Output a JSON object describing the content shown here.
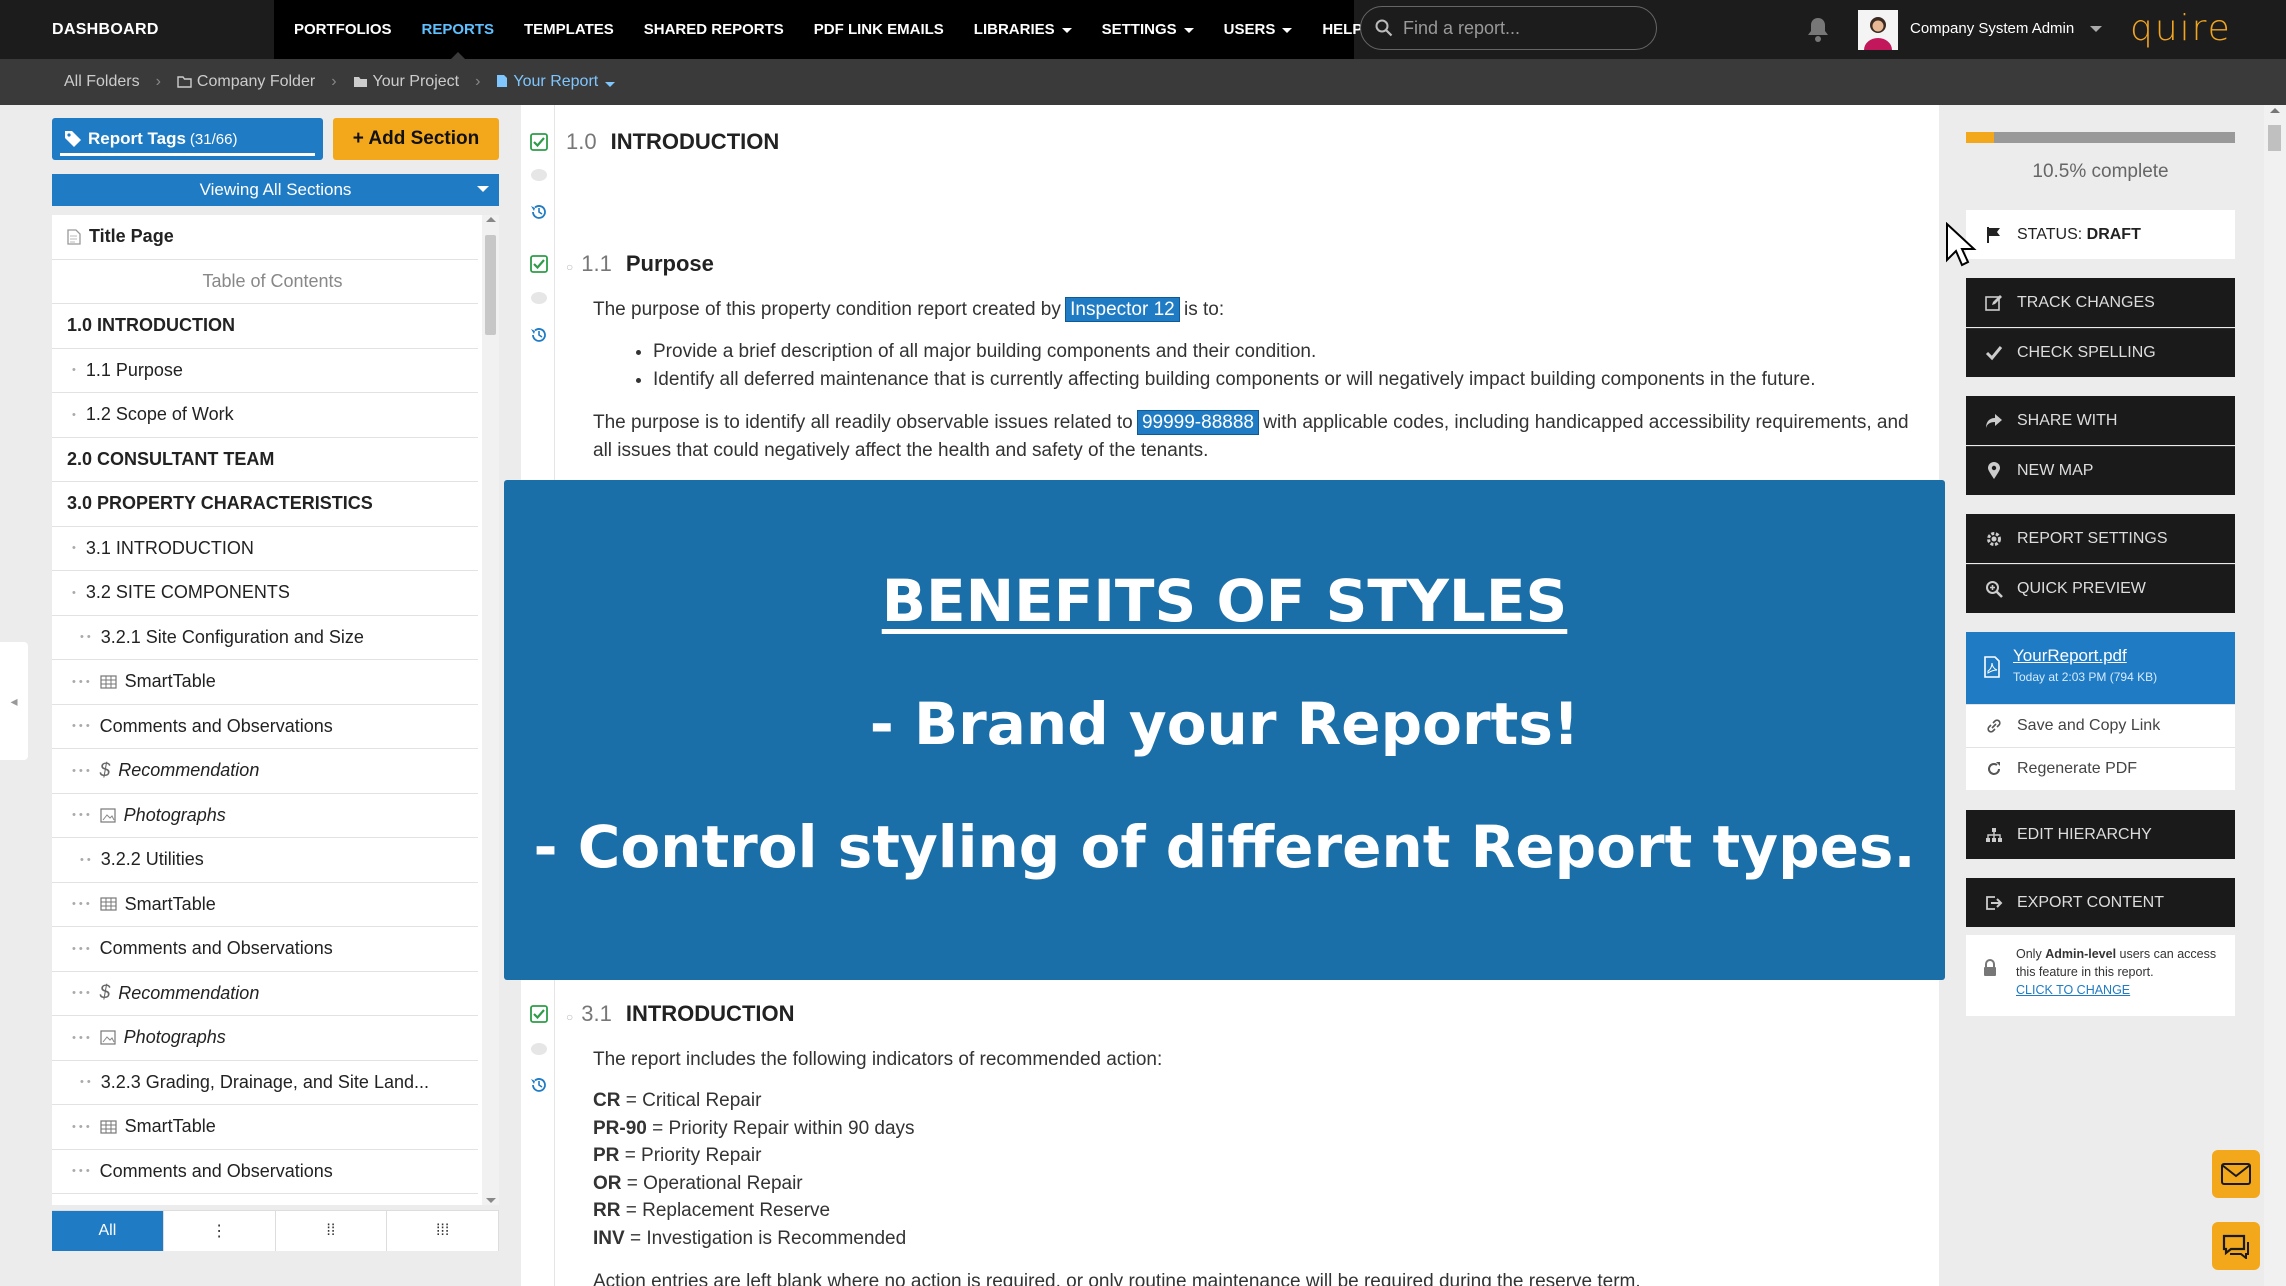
{
  "nav": {
    "dashboard": "DASHBOARD",
    "items": [
      {
        "label": "PORTFOLIOS",
        "caret": false
      },
      {
        "label": "REPORTS",
        "caret": false,
        "active": true
      },
      {
        "label": "TEMPLATES",
        "caret": false
      },
      {
        "label": "SHARED REPORTS",
        "caret": false
      },
      {
        "label": "PDF LINK EMAILS",
        "caret": false
      },
      {
        "label": "LIBRARIES",
        "caret": true
      },
      {
        "label": "SETTINGS",
        "caret": true
      },
      {
        "label": "USERS",
        "caret": true
      },
      {
        "label": "HELP",
        "caret": false
      }
    ],
    "search_placeholder": "Find a report...",
    "user_name": "Company System Admin",
    "logo": "quire"
  },
  "breadcrumb": {
    "items": [
      "All Folders",
      "Company Folder",
      "Your Project",
      "Your Report"
    ]
  },
  "left": {
    "tags_label": "Report Tags",
    "tags_count": "(31/66)",
    "add_section": "+ Add Section",
    "viewing": "Viewing All Sections",
    "toc": [
      {
        "label": "Title Page",
        "style": "bold",
        "indent": 0,
        "icon": "page"
      },
      {
        "label": "Table of Contents",
        "style": "center",
        "indent": 0
      },
      {
        "label": "1.0 INTRODUCTION",
        "style": "bold",
        "indent": 0
      },
      {
        "label": "1.1 Purpose",
        "indent": 1
      },
      {
        "label": "1.2 Scope of Work",
        "indent": 1
      },
      {
        "label": "2.0 CONSULTANT TEAM",
        "style": "bold",
        "indent": 0
      },
      {
        "label": "3.0 PROPERTY CHARACTERISTICS",
        "style": "bold",
        "indent": 0
      },
      {
        "label": "3.1 INTRODUCTION",
        "indent": 1
      },
      {
        "label": "3.2 SITE COMPONENTS",
        "indent": 1
      },
      {
        "label": "3.2.1 Site Configuration and Size",
        "indent": 2
      },
      {
        "label": "SmartTable",
        "indent": 3,
        "icon": "table"
      },
      {
        "label": "Comments and Observations",
        "indent": 3
      },
      {
        "label": "Recommendation",
        "style": "italic",
        "indent": 3,
        "icon": "dollar"
      },
      {
        "label": "Photographs",
        "style": "italic",
        "indent": 3,
        "icon": "image"
      },
      {
        "label": "3.2.2 Utilities",
        "indent": 2
      },
      {
        "label": "SmartTable",
        "indent": 3,
        "icon": "table"
      },
      {
        "label": "Comments and Observations",
        "indent": 3
      },
      {
        "label": "Recommendation",
        "style": "italic",
        "indent": 3,
        "icon": "dollar"
      },
      {
        "label": "Photographs",
        "style": "italic",
        "indent": 3,
        "icon": "image"
      },
      {
        "label": "3.2.3 Grading, Drainage, and Site Land...",
        "indent": 2
      },
      {
        "label": "SmartTable",
        "indent": 3,
        "icon": "table"
      },
      {
        "label": "Comments and Observations",
        "indent": 3
      }
    ],
    "bottom_tabs": [
      "All",
      "⋮",
      "⁞⁞",
      "⁞⁞⁞"
    ]
  },
  "doc": {
    "s1_num": "1.0",
    "s1_title": "INTRODUCTION",
    "s11_num": "1.1",
    "s11_title": "Purpose",
    "p1_before": "The purpose of this property condition report created by",
    "p1_tag": "Inspector 12",
    "p1_after": "is to:",
    "bullets": [
      "Provide a brief description of all major building components and their condition.",
      "Identify all deferred maintenance that is currently affecting building components or will negatively impact building components in the future."
    ],
    "p2_before": "The purpose is to identify all readily observable issues related to",
    "p2_tag": "99999-88888",
    "p2_after": "with applicable codes, including handicapped accessibility requirements, and all issues that could negatively affect the health and safety of the tenants.",
    "s31_num": "3.1",
    "s31_title": "INTRODUCTION",
    "p3": "The report includes the following indicators of recommended action:",
    "indicators": [
      {
        "code": "CR",
        "desc": "= Critical Repair"
      },
      {
        "code": "PR-90",
        "desc": "= Priority Repair within 90 days"
      },
      {
        "code": "PR",
        "desc": "= Priority Repair"
      },
      {
        "code": "OR",
        "desc": "= Operational Repair"
      },
      {
        "code": "RR",
        "desc": "= Replacement Reserve"
      },
      {
        "code": "INV",
        "desc": "= Investigation is Recommended"
      }
    ],
    "p4": "Action entries are left blank where no action is required, or only routine maintenance will be required during the reserve term."
  },
  "overlay": {
    "line1": "BENEFITS OF STYLES",
    "line2": "- Brand your Reports!",
    "line3": "- Control styling of different Report types."
  },
  "right": {
    "progress_fraction": 0.105,
    "progress_text": "10.5% complete",
    "status_label": "STATUS:",
    "status_value": "DRAFT",
    "track_changes": "TRACK CHANGES",
    "check_spelling": "CHECK SPELLING",
    "share_with": "SHARE WITH",
    "new_map": "NEW MAP",
    "report_settings": "REPORT SETTINGS",
    "quick_preview": "QUICK PREVIEW",
    "pdf_name": "YourReport.pdf",
    "pdf_meta": "Today at 2:03 PM (794 KB)",
    "save_copy": "Save and Copy Link",
    "regenerate": "Regenerate PDF",
    "edit_hierarchy": "EDIT HIERARCHY",
    "export_content": "EXPORT CONTENT",
    "lock_pre": "Only",
    "lock_bold": "Admin-level",
    "lock_post": "users can access this feature in this report.",
    "lock_link": "CLICK TO CHANGE"
  },
  "colors": {
    "accent": "#1f7bc4",
    "orange": "#f3a81c",
    "topbar": "#1c1c1c"
  }
}
